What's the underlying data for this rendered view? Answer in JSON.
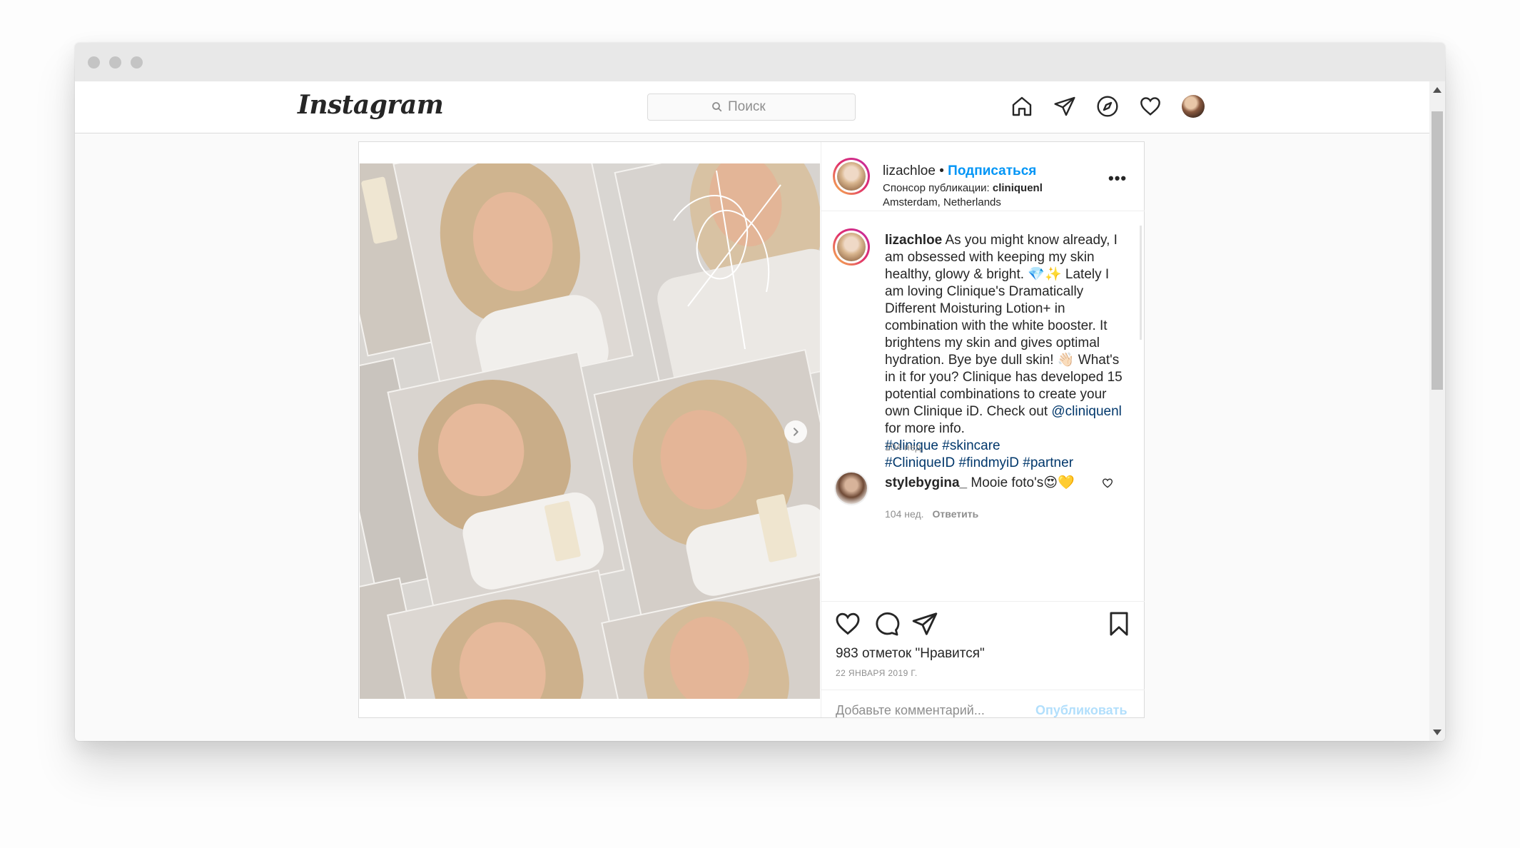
{
  "app": {
    "logo_text": "Instagram"
  },
  "search": {
    "placeholder": "Поиск"
  },
  "nav": {
    "icons": [
      "home-icon",
      "direct-icon",
      "explore-icon",
      "heart-icon",
      "profile-avatar"
    ]
  },
  "post": {
    "author": "lizachloe",
    "separator": "•",
    "follow_label": "Подписаться",
    "sponsor_prefix": "Спонсор публикации: ",
    "sponsor_name": "cliniquenl",
    "location": "Amsterdam, Netherlands",
    "more_label": "•••",
    "caption": {
      "user": "lizachloe",
      "text_1": "As you might know already, I am obsessed with keeping my skin healthy, glowy & bright. 💎✨ Lately I am loving Clinique's Dramatically Different Moisturing Lotion+ in combination with the white booster. It brightens my skin and gives optimal hydration. Bye bye dull skin! 👋🏻 What's in it for you? Clinique has developed 15 potential combinations to create your own Clinique iD. Check out ",
      "mention": "@cliniquenl",
      "text_2": " for more info.",
      "hashtags_line1": "#clinique #skincare",
      "hashtags_line2": "#CliniqueID #findmyiD #partner",
      "time": "104 нед."
    },
    "comments": [
      {
        "user": "stylebygina_",
        "text": "Mooie foto's😍💛",
        "time": "104 нед.",
        "reply_label": "Ответить"
      }
    ],
    "likes_text": "983 отметок \"Нравится\"",
    "date_text": "22 ЯНВАРЯ 2019 Г.",
    "comment_placeholder": "Добавьте комментарий...",
    "publish_label": "Опубликовать"
  },
  "colors": {
    "accent_blue": "#0095f6",
    "link_blue": "#00376b",
    "publish_disabled": "#b2dffc",
    "text": "#262626",
    "muted": "#8e8e8e",
    "border": "#dbdbdb"
  }
}
